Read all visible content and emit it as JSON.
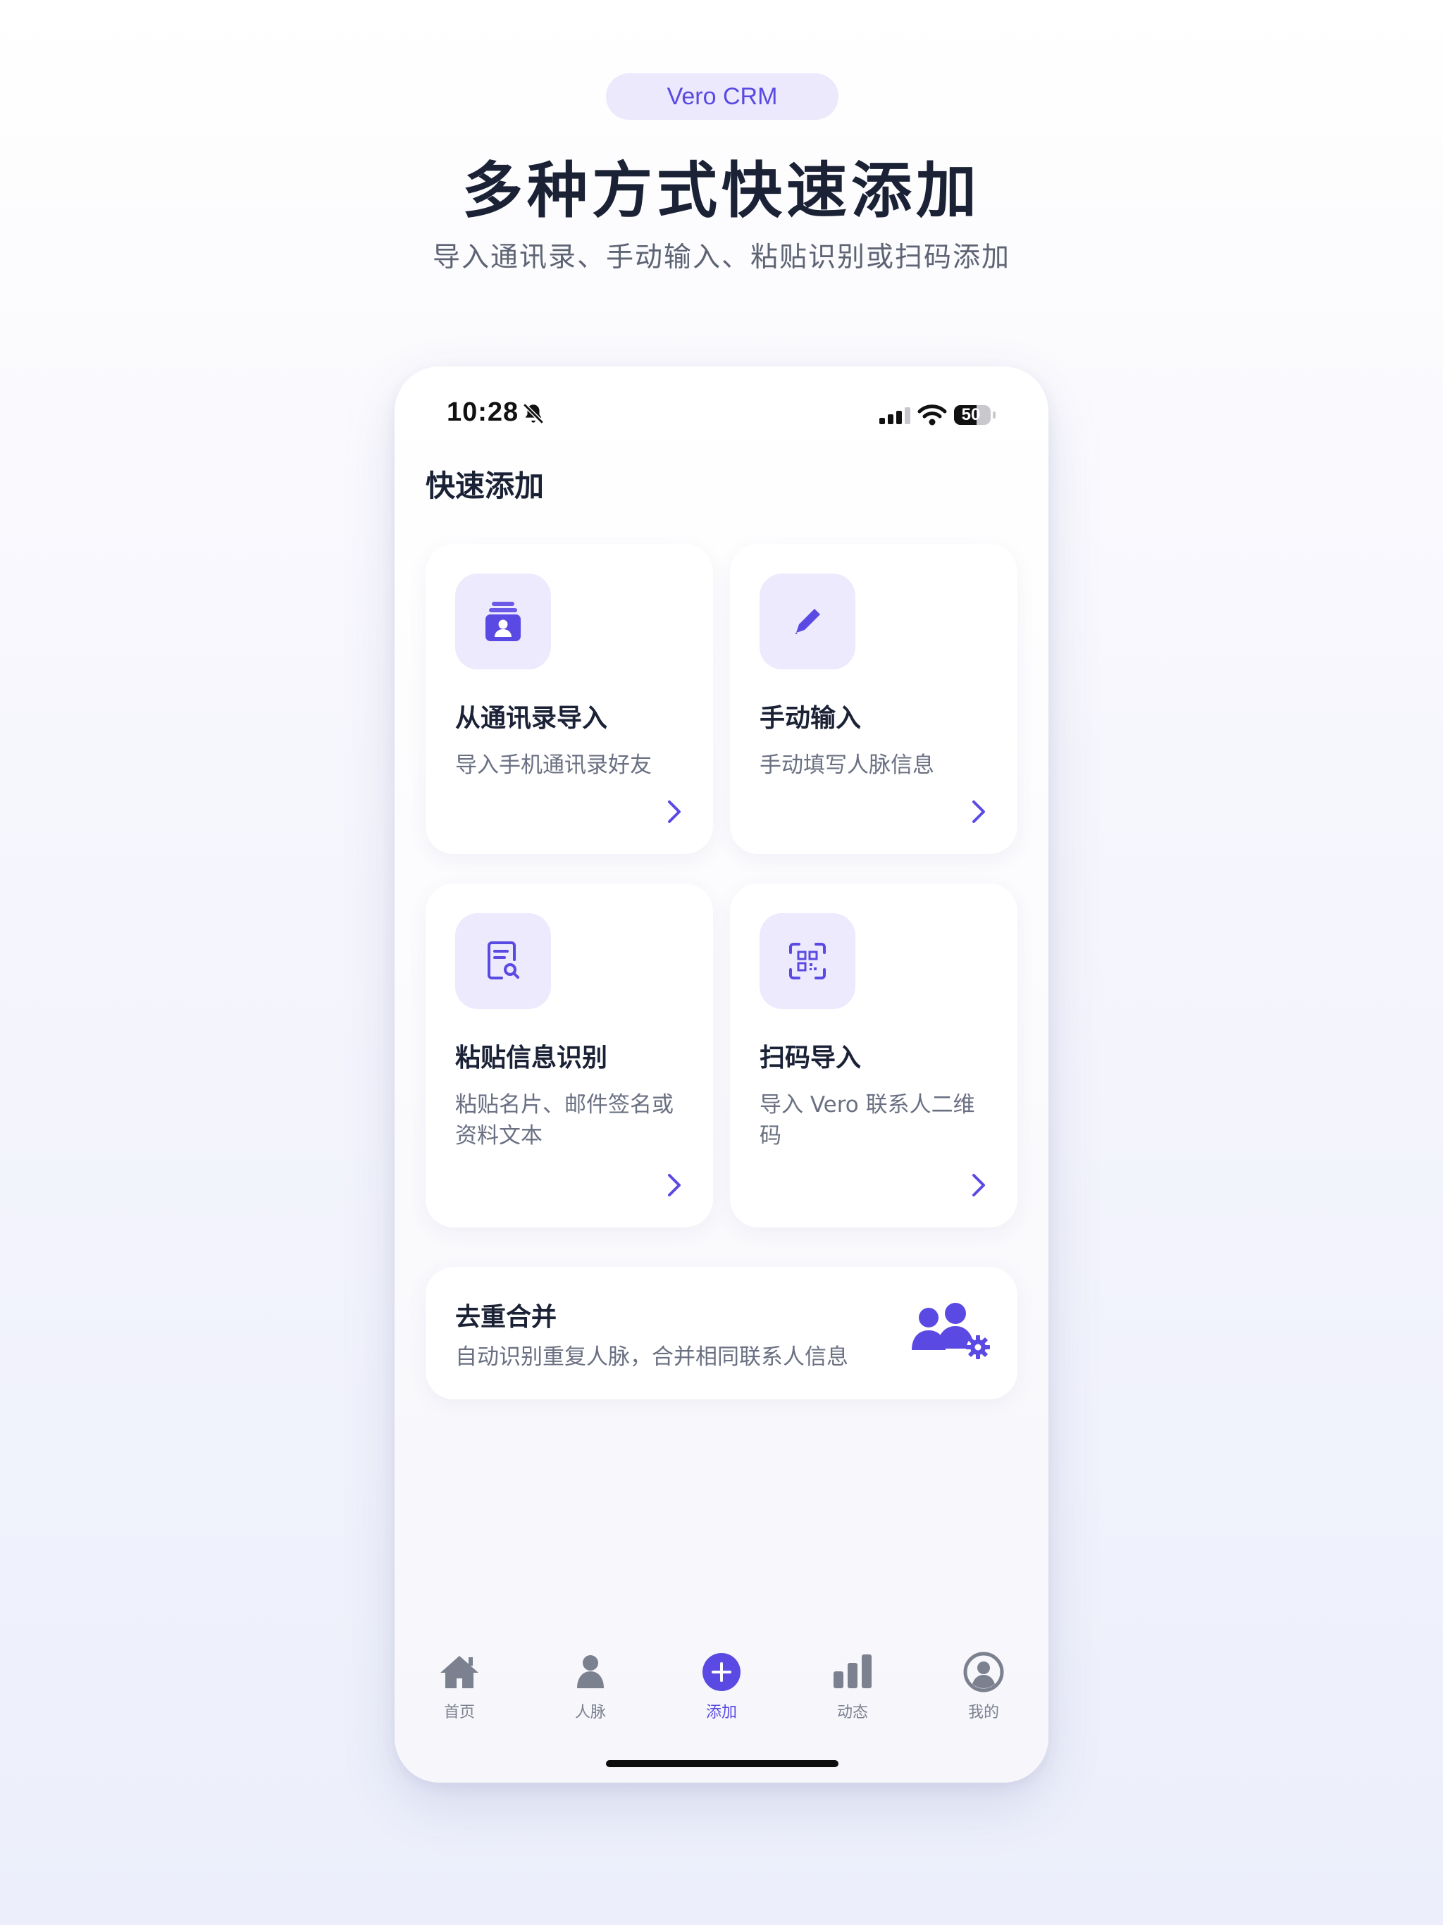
{
  "badge": "Vero CRM",
  "headline": "多种方式快速添加",
  "subheadline": "导入通讯录、手动输入、粘贴识别或扫码添加",
  "status": {
    "time": "10:28",
    "battery": "50",
    "icons": [
      "bell-slash-icon",
      "signal-icon",
      "wifi-icon",
      "battery-icon"
    ]
  },
  "screen": {
    "title": "快速添加"
  },
  "cards": [
    {
      "title": "从通讯录导入",
      "desc": "导入手机通讯录好友",
      "icon": "contacts-icon"
    },
    {
      "title": "手动输入",
      "desc": "手动填写人脉信息",
      "icon": "pencil-icon"
    },
    {
      "title": "粘贴信息识别",
      "desc": "粘贴名片、邮件签名或资料文本",
      "icon": "document-search-icon"
    },
    {
      "title": "扫码导入",
      "desc": "导入 Vero 联系人二维码",
      "icon": "qr-scan-icon"
    }
  ],
  "merge": {
    "title": "去重合并",
    "desc": "自动识别重复人脉，合并相同联系人信息",
    "icon": "users-gear-icon"
  },
  "tabs": [
    {
      "label": "首页",
      "icon": "home-icon",
      "active": false
    },
    {
      "label": "人脉",
      "icon": "person-icon",
      "active": false
    },
    {
      "label": "添加",
      "icon": "plus-circle-icon",
      "active": true
    },
    {
      "label": "动态",
      "icon": "bar-chart-icon",
      "active": false
    },
    {
      "label": "我的",
      "icon": "profile-icon",
      "active": false
    }
  ],
  "colors": {
    "accent": "#5a4ae3",
    "accent_light": "#eceafc",
    "text_primary": "#1b2236",
    "text_secondary": "#6a7082",
    "tab_inactive": "#7c8190"
  }
}
